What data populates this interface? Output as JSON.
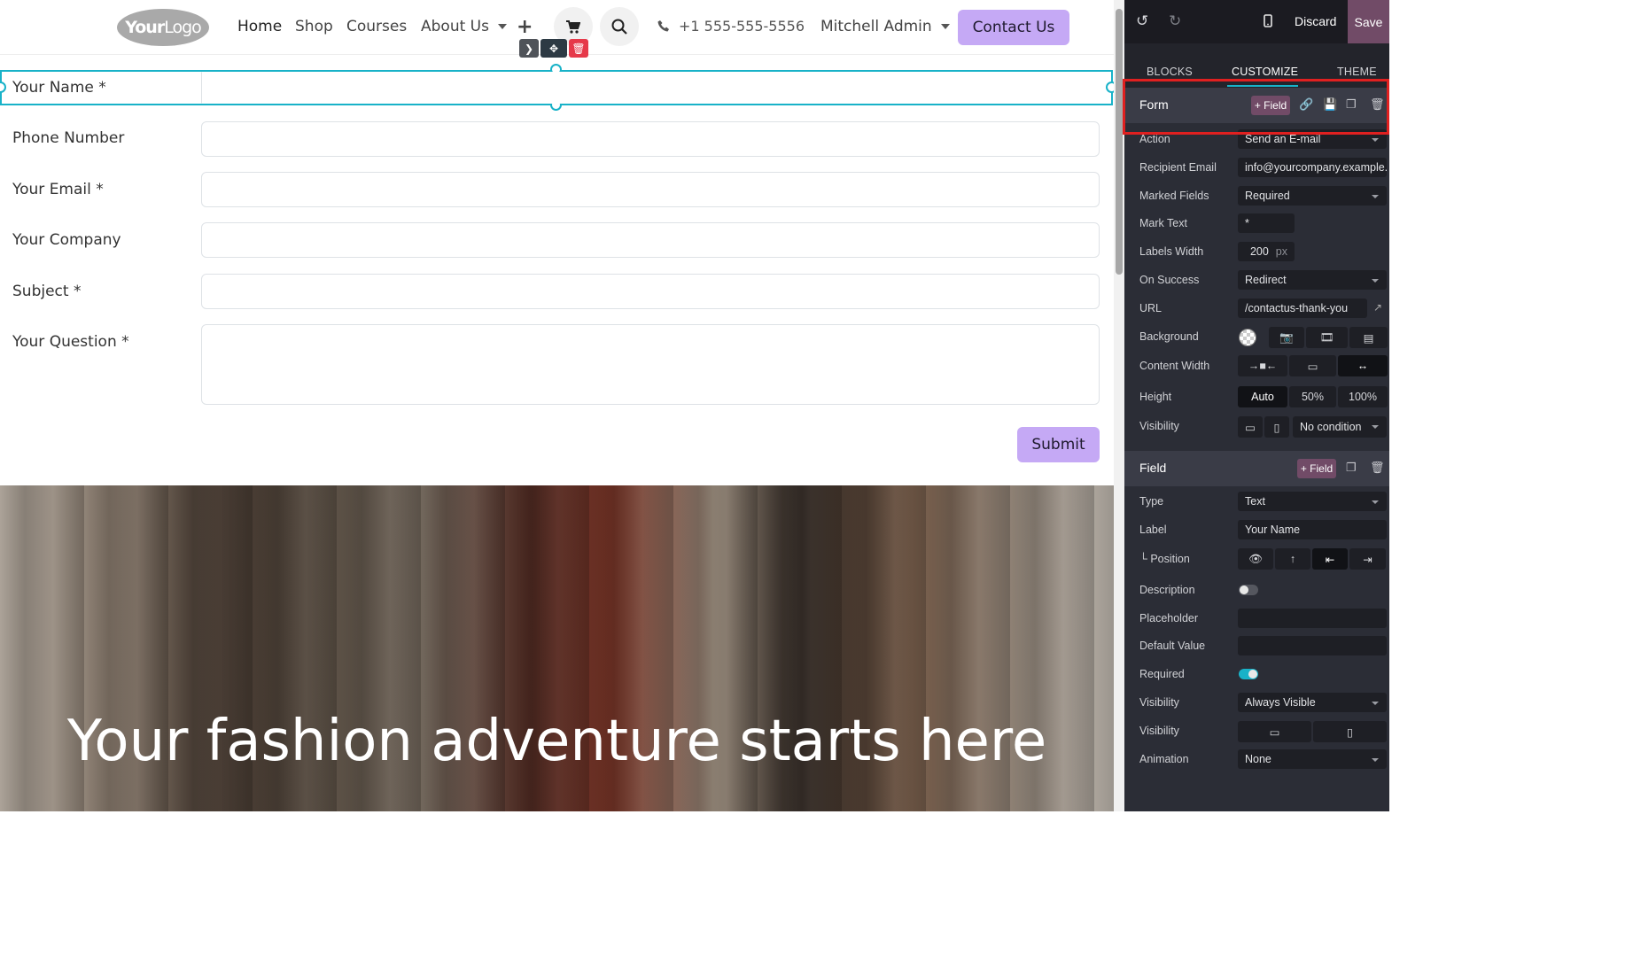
{
  "navbar": {
    "logo_bold": "Your",
    "logo_light": "Logo",
    "items": [
      "Home",
      "Shop",
      "Courses",
      "About Us"
    ],
    "phone": "+1 555-555-5556",
    "user": "Mitchell Admin",
    "contact_label": "Contact Us"
  },
  "form": {
    "fields": [
      {
        "label": "Your Name *"
      },
      {
        "label": "Phone Number"
      },
      {
        "label": "Your Email *"
      },
      {
        "label": "Your Company"
      },
      {
        "label": "Subject *"
      },
      {
        "label": "Your Question *"
      }
    ],
    "submit_label": "Submit"
  },
  "hero": {
    "title": "Your fashion adventure starts here"
  },
  "panel": {
    "discard": "Discard",
    "save": "Save",
    "tabs": [
      "BLOCKS",
      "CUSTOMIZE",
      "THEME"
    ],
    "form_section": {
      "title": "Form",
      "add_field": "+ Field",
      "action_label": "Action",
      "action_value": "Send an E-mail",
      "recipient_label": "Recipient Email",
      "recipient_value": "info@yourcompany.example.com",
      "marked_label": "Marked Fields",
      "marked_value": "Required",
      "mark_text_label": "Mark Text",
      "mark_text_value": "*",
      "labels_width_label": "Labels Width",
      "labels_width_value": "200",
      "labels_width_unit": "px",
      "on_success_label": "On Success",
      "on_success_value": "Redirect",
      "url_label": "URL",
      "url_value": "/contactus-thank-you",
      "background_label": "Background",
      "content_width_label": "Content Width",
      "height_label": "Height",
      "height_options": [
        "Auto",
        "50%",
        "100%"
      ],
      "visibility_label": "Visibility",
      "visibility_value": "No condition"
    },
    "field_section": {
      "title": "Field",
      "add_field": "+ Field",
      "type_label": "Type",
      "type_value": "Text",
      "label_label": "Label",
      "label_value": "Your Name",
      "position_label": "└ Position",
      "description_label": "Description",
      "placeholder_label": "Placeholder",
      "default_label": "Default Value",
      "required_label": "Required",
      "visibility_label": "Visibility",
      "visibility_value": "Always Visible",
      "visibility2_label": "Visibility",
      "animation_label": "Animation",
      "animation_value": "None"
    }
  },
  "colors": {
    "accent": "#c5a9f5",
    "selection": "#18b2c8",
    "odoo_purple": "#714b67",
    "highlight": "#e02020"
  }
}
